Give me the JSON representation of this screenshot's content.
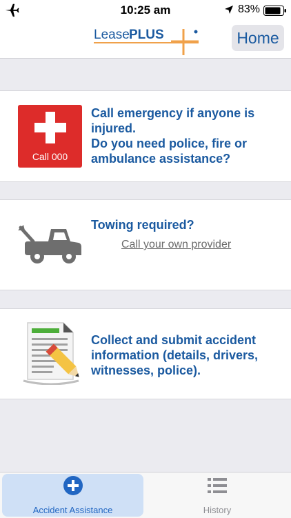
{
  "status_bar": {
    "time": "10:25 am",
    "battery": "83%"
  },
  "header": {
    "logo_text_lease": "Lease",
    "logo_text_plus": "PLUS",
    "home_label": "Home"
  },
  "cards": [
    {
      "button_label": "Call 000",
      "lines": [
        "Call emergency if anyone is",
        "injured.",
        "Do you need police, fire or",
        "ambulance assistance?"
      ]
    },
    {
      "lines": [
        "Towing required?"
      ],
      "link": "Call your own provider"
    },
    {
      "lines": [
        "Collect and submit accident",
        "information (details, drivers,",
        "witnesses, police)."
      ]
    }
  ],
  "tabs": [
    {
      "label": "Accident Assistance",
      "icon": "plus-circle-icon",
      "active": true
    },
    {
      "label": "History",
      "icon": "list-icon",
      "active": false
    }
  ],
  "colors": {
    "accent_blue": "#1b5aa0",
    "emergency_red": "#dd2c2a",
    "logo_orange": "#f0a14a",
    "tab_active_bg": "#cfe0f6"
  }
}
